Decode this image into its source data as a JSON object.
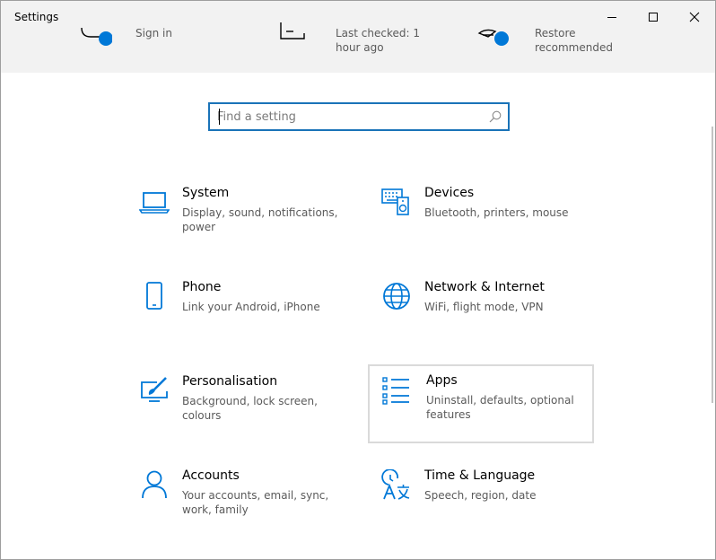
{
  "window": {
    "title": "Settings",
    "controls": {
      "minimize": "minimize-icon",
      "maximize": "maximize-icon",
      "close": "close-icon"
    }
  },
  "banner": {
    "items": [
      {
        "icon": "account-toggle-icon",
        "text": "Sign in"
      },
      {
        "icon": "windows-update-icon",
        "text": "Last checked: 1 hour ago"
      },
      {
        "icon": "onedrive-icon",
        "text": "Restore recommended"
      }
    ]
  },
  "search": {
    "placeholder": "Find a setting",
    "value": ""
  },
  "categories": [
    {
      "title": "System",
      "description": "Display, sound, notifications, power",
      "icon": "laptop-icon"
    },
    {
      "title": "Devices",
      "description": "Bluetooth, printers, mouse",
      "icon": "keyboard-speaker-icon"
    },
    {
      "title": "Phone",
      "description": "Link your Android, iPhone",
      "icon": "phone-icon"
    },
    {
      "title": "Network & Internet",
      "description": "WiFi, flight mode, VPN",
      "icon": "globe-icon"
    },
    {
      "title": "Personalisation",
      "description": "Background, lock screen, colours",
      "icon": "paint-brush-icon"
    },
    {
      "title": "Apps",
      "description": "Uninstall, defaults, optional features",
      "icon": "app-list-icon",
      "selected": true
    },
    {
      "title": "Accounts",
      "description": "Your accounts, email, sync, work, family",
      "icon": "person-icon"
    },
    {
      "title": "Time & Language",
      "description": "Speech, region, date",
      "icon": "clock-language-icon"
    }
  ],
  "colors": {
    "accent": "#0078d7",
    "title_bar": "#f2f2f2",
    "selected_border": "#dadada"
  }
}
